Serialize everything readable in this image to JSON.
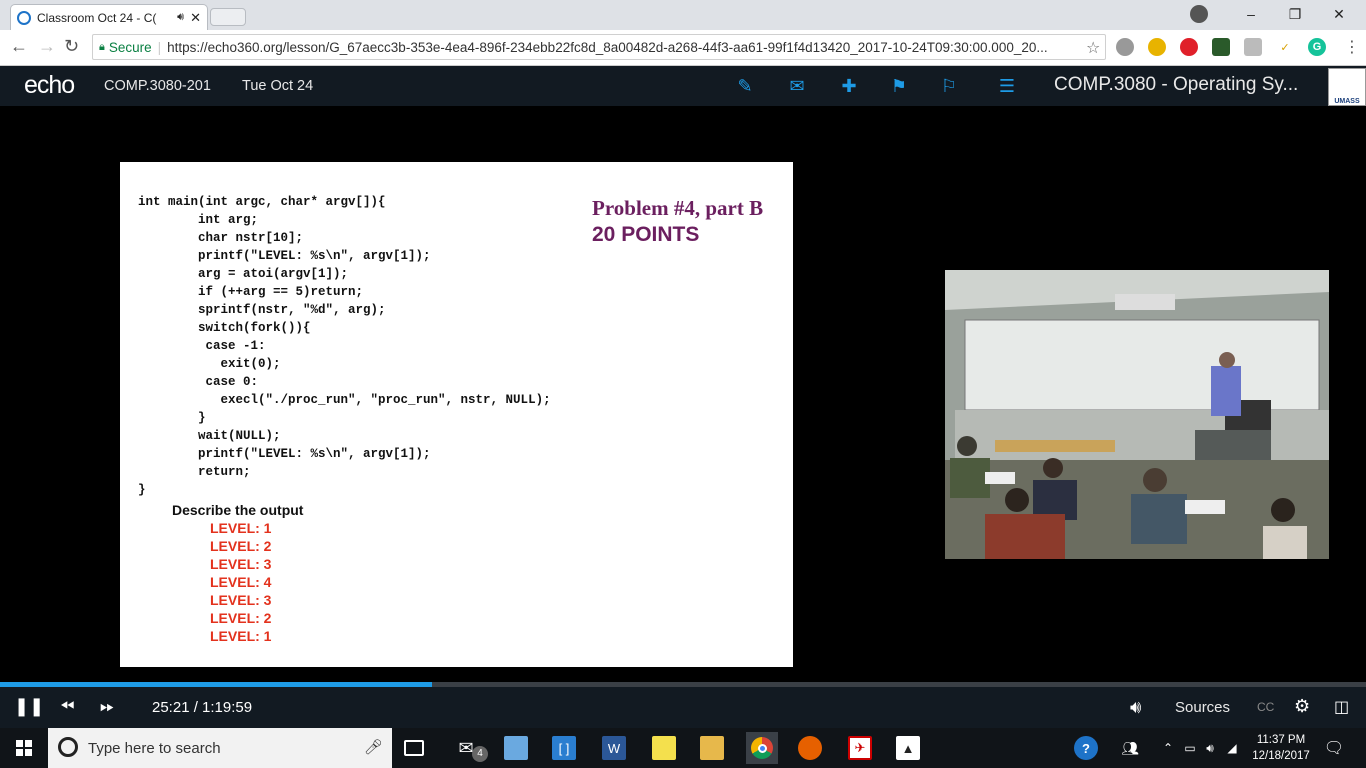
{
  "browser": {
    "tab_title": "Classroom Oct 24 - C(",
    "secure_label": "Secure",
    "url": "https://echo360.org/lesson/G_67aecc3b-353e-4ea4-896f-234ebb22fc8d_8a00482d-a268-44f3-aa61-99f1f4d13420_2017-10-24T09:30:00.000_20..."
  },
  "echo": {
    "logo": "echo",
    "course_code": "COMP.3080-201",
    "date": "Tue Oct 24",
    "course_title": "COMP.3080 - Operating Sy...",
    "umass_label": "UMASS"
  },
  "slide": {
    "title": "Problem #4, part B",
    "points": "20 POINTS",
    "code_lines": [
      "int main(int argc, char* argv[]){",
      "        int arg;",
      "        char nstr[10];",
      "        printf(\"LEVEL: %s\\n\", argv[1]);",
      "        arg = atoi(argv[1]);",
      "        if (++arg == 5)return;",
      "        sprintf(nstr, \"%d\", arg);",
      "        switch(fork()){",
      "         case -1:",
      "           exit(0);",
      "         case 0:",
      "           execl(\"./proc_run\", \"proc_run\", nstr, NULL);",
      "        }",
      "        wait(NULL);",
      "        printf(\"LEVEL: %s\\n\", argv[1]);",
      "        return;",
      "}"
    ],
    "describe": "Describe the output",
    "output_lines": [
      "LEVEL: 1",
      "LEVEL: 2",
      "LEVEL: 3",
      "LEVEL: 4",
      "LEVEL: 3",
      "LEVEL: 2",
      "LEVEL: 1"
    ]
  },
  "player": {
    "progress_fraction": 0.3166,
    "timecode": "25:21 / 1:19:59",
    "sources_label": "Sources",
    "cc_label": "CC"
  },
  "taskbar": {
    "search_placeholder": "Type here to search",
    "mail_badge": "4",
    "time": "11:37 PM",
    "date": "12/18/2017"
  },
  "colors": {
    "accent": "#1e9be6",
    "header_bg": "#121a22",
    "slide_title": "#6b1f5f",
    "output_red": "#e3321d"
  }
}
